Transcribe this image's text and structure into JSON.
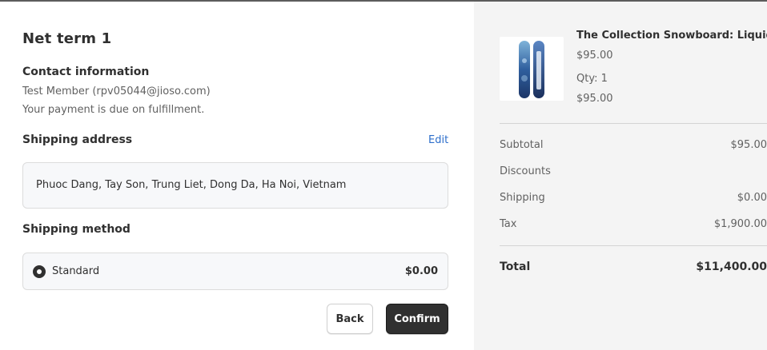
{
  "page": {
    "title": "Net term 1"
  },
  "contact": {
    "heading": "Contact information",
    "member": "Test Member (rpv05044@jioso.com)",
    "payment_note": "Your payment is due on fulfillment."
  },
  "shipping_address": {
    "heading": "Shipping address",
    "edit_label": "Edit",
    "address": "Phuoc Dang, Tay Son, Trung Liet, Dong Da, Ha Noi, Vietnam"
  },
  "shipping_method": {
    "heading": "Shipping method",
    "option_name": "Standard",
    "option_price": "$0.00",
    "selected": true
  },
  "buttons": {
    "back": "Back",
    "confirm": "Confirm"
  },
  "summary": {
    "product": {
      "name": "The Collection Snowboard: Liquid",
      "unit_price": "$95.00",
      "qty": "Qty: 1",
      "line_total": "$95.00",
      "image_icon": "snowboard-image"
    },
    "rows": [
      {
        "label": "Subtotal",
        "value": "$95.00"
      },
      {
        "label": "Discounts",
        "value": ""
      },
      {
        "label": "Shipping",
        "value": "$0.00"
      },
      {
        "label": "Tax",
        "value": "$1,900.00"
      }
    ],
    "total": {
      "label": "Total",
      "value": "$11,400.00"
    }
  },
  "colors": {
    "accent_link": "#2c6ecb",
    "primary_button": "#303030",
    "summary_bg": "#f4f4f4"
  }
}
